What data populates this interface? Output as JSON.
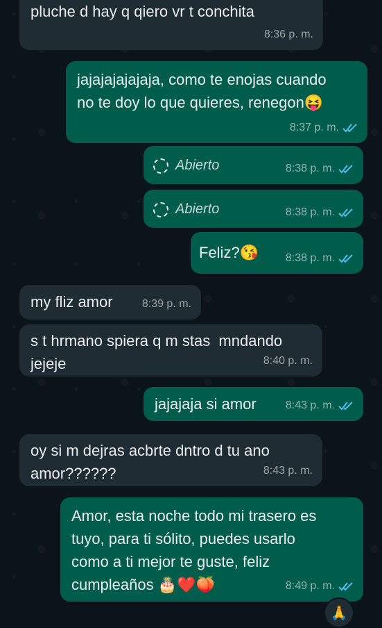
{
  "messages": [
    {
      "text": "pluche d hay q qiero vr t conchita",
      "time": "8:36 p. m."
    },
    {
      "text": "jajajajajajaja, como te enojas cuando\nno te doy lo que quieres, renegon",
      "emoji": "😝",
      "time": "8:37 p. m."
    },
    {
      "label": "Abierto",
      "time": "8:38 p. m."
    },
    {
      "label": "Abierto",
      "time": "8:38 p. m."
    },
    {
      "text": "Feliz?",
      "emoji": "😘",
      "time": "8:38 p. m."
    },
    {
      "text": "my fliz amor",
      "time": "8:39 p. m."
    },
    {
      "text": "s t hrmano spiera q m stas  mndando\njejeje",
      "time": "8:40 p. m."
    },
    {
      "text": "jajajaja si amor",
      "time": "8:43 p. m."
    },
    {
      "text": "oy si m dejras acbrte dntro d tu ano\namor??????",
      "time": "8:43 p. m."
    },
    {
      "text": "Amor, esta noche todo mi trasero es\ntuyo, para ti sólito, puedes usarlo\ncomo a ti mejor te guste, feliz\ncumpleaños",
      "emoji": "🎂❤️🍑",
      "time": "8:49 p. m."
    }
  ],
  "reaction": "🙏",
  "colors": {
    "incoming": "#202c33",
    "outgoing": "#005c4b",
    "read_ticks": "#53bdeb",
    "background": "#0b141a"
  }
}
